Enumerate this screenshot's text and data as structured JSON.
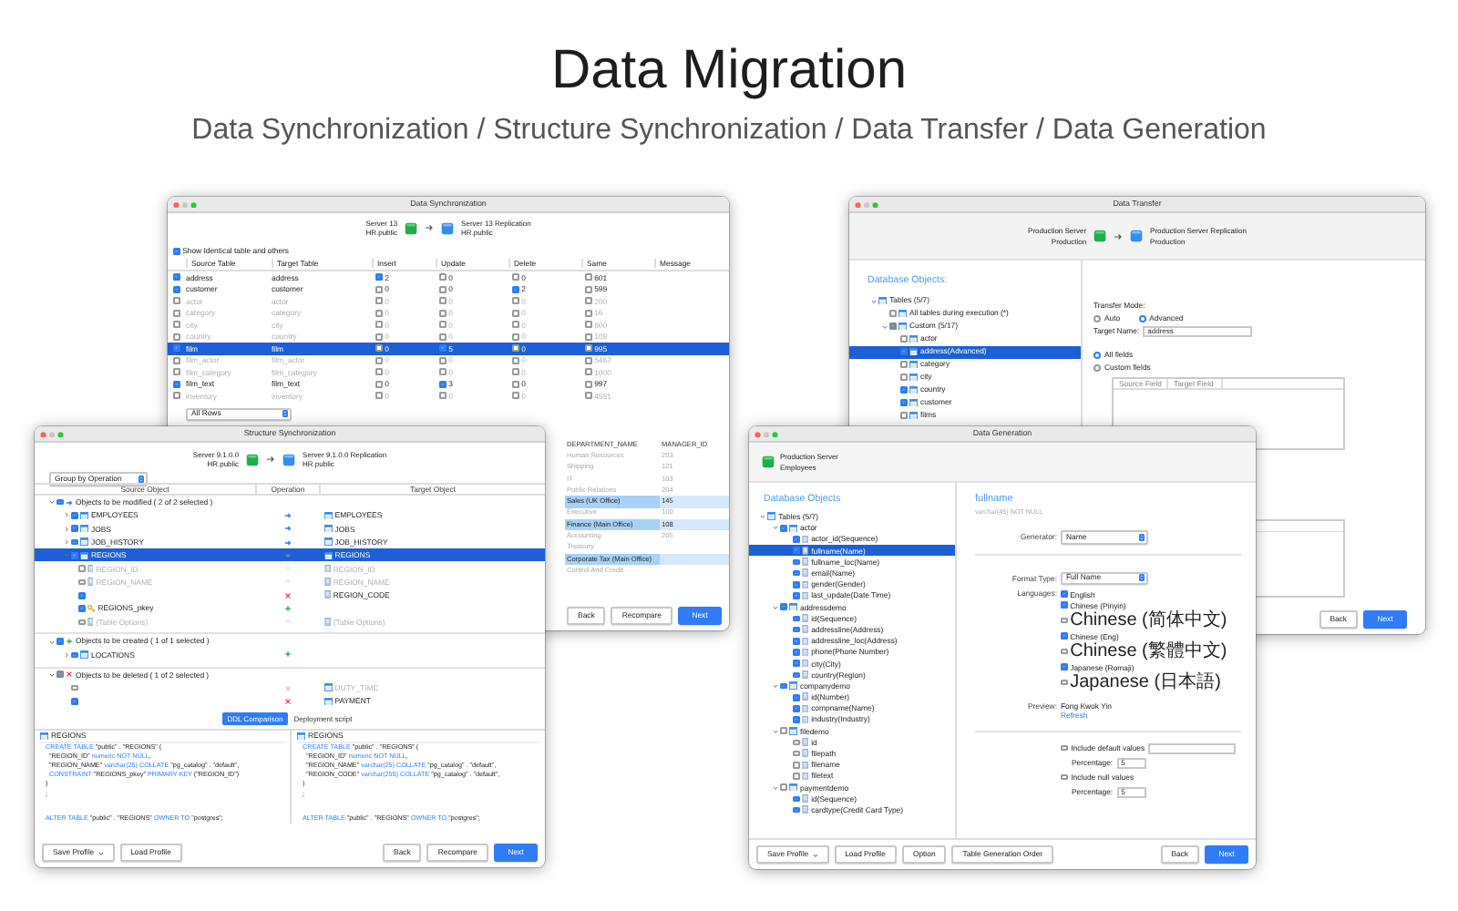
{
  "header": {
    "title": "Data Migration",
    "subtitle": "Data Synchronization / Structure Synchronization / Data Transfer / Data Generation"
  },
  "data_synchronization": {
    "title": "Data Synchronization",
    "source": {
      "name": "Server 13",
      "schema": "HR.public"
    },
    "target": {
      "name": "Server 13 Replication",
      "schema": "HR.public"
    },
    "show_identical": {
      "label": "Show Identical table and others",
      "checked": true
    },
    "columns": [
      "Source Table",
      "Target Table",
      "Insert",
      "Update",
      "Delete",
      "Same",
      "Message"
    ],
    "rows": [
      {
        "checked": true,
        "selected": false,
        "source": "address",
        "target": "address",
        "counts": [
          {
            "value": "2",
            "checked": true
          },
          {
            "value": "0",
            "checked": false
          },
          {
            "value": "0",
            "checked": false
          },
          {
            "value": "601",
            "checked": false
          }
        ]
      },
      {
        "checked": true,
        "selected": false,
        "source": "customer",
        "target": "customer",
        "counts": [
          {
            "value": "0",
            "checked": false
          },
          {
            "value": "0",
            "checked": false
          },
          {
            "value": "2",
            "checked": true
          },
          {
            "value": "599",
            "checked": false
          }
        ]
      },
      {
        "checked": false,
        "selected": false,
        "source": "actor",
        "target": "actor",
        "counts": [
          {
            "value": "0",
            "checked": false
          },
          {
            "value": "0",
            "checked": false
          },
          {
            "value": "0",
            "checked": false
          },
          {
            "value": "200",
            "checked": false
          }
        ]
      },
      {
        "checked": false,
        "selected": false,
        "source": "category",
        "target": "category",
        "counts": [
          {
            "value": "0",
            "checked": false
          },
          {
            "value": "0",
            "checked": false
          },
          {
            "value": "0",
            "checked": false
          },
          {
            "value": "16",
            "checked": false
          }
        ]
      },
      {
        "checked": false,
        "selected": false,
        "source": "city",
        "target": "city",
        "counts": [
          {
            "value": "0",
            "checked": false
          },
          {
            "value": "0",
            "checked": false
          },
          {
            "value": "0",
            "checked": false
          },
          {
            "value": "600",
            "checked": false
          }
        ]
      },
      {
        "checked": false,
        "selected": false,
        "source": "country",
        "target": "country",
        "counts": [
          {
            "value": "0",
            "checked": false
          },
          {
            "value": "0",
            "checked": false
          },
          {
            "value": "0",
            "checked": false
          },
          {
            "value": "109",
            "checked": false
          }
        ]
      },
      {
        "checked": true,
        "selected": true,
        "source": "film",
        "target": "film",
        "counts": [
          {
            "value": "0",
            "checked": false
          },
          {
            "value": "5",
            "checked": true
          },
          {
            "value": "0",
            "checked": false
          },
          {
            "value": "995",
            "checked": false
          }
        ]
      },
      {
        "checked": false,
        "selected": false,
        "source": "film_actor",
        "target": "film_actor",
        "counts": [
          {
            "value": "0",
            "checked": false
          },
          {
            "value": "0",
            "checked": false
          },
          {
            "value": "0",
            "checked": false
          },
          {
            "value": "5462",
            "checked": false
          }
        ]
      },
      {
        "checked": false,
        "selected": false,
        "source": "film_category",
        "target": "film_category",
        "counts": [
          {
            "value": "0",
            "checked": false
          },
          {
            "value": "0",
            "checked": false
          },
          {
            "value": "0",
            "checked": false
          },
          {
            "value": "1000",
            "checked": false
          }
        ]
      },
      {
        "checked": true,
        "selected": false,
        "source": "film_text",
        "target": "film_text",
        "counts": [
          {
            "value": "0",
            "checked": false
          },
          {
            "value": "3",
            "checked": true
          },
          {
            "value": "0",
            "checked": false
          },
          {
            "value": "997",
            "checked": false
          }
        ]
      },
      {
        "checked": false,
        "selected": false,
        "source": "inventory",
        "target": "inventory",
        "counts": [
          {
            "value": "0",
            "checked": false
          },
          {
            "value": "0",
            "checked": false
          },
          {
            "value": "0",
            "checked": false
          },
          {
            "value": "4581",
            "checked": false
          }
        ]
      }
    ],
    "filter": "All Rows",
    "preview": {
      "columns": [
        "DEPARTMENT_NAME",
        "MANAGER_ID"
      ],
      "rows": [
        {
          "cells": [
            "Human Resources",
            "203"
          ],
          "changed": false
        },
        {
          "cells": [
            "Shipping",
            "121"
          ],
          "changed": false
        },
        {
          "cells": [
            "IT",
            "103"
          ],
          "changed": false
        },
        {
          "cells": [
            "Public Relations",
            "204"
          ],
          "changed": false
        },
        {
          "cells": [
            "Sales (UK Office)",
            "145"
          ],
          "changed": true
        },
        {
          "cells": [
            "Executive",
            "100"
          ],
          "changed": false
        },
        {
          "cells": [
            "Finance (Main Office)",
            "108"
          ],
          "changed": true
        },
        {
          "cells": [
            "Accounting",
            "205"
          ],
          "changed": false
        },
        {
          "cells": [
            "Treasury"
          ],
          "changed": false
        },
        {
          "cells": [
            "Corporate Tax (Main Office)"
          ],
          "changed": true
        },
        {
          "cells": [
            "Control And Credit"
          ],
          "changed": false
        }
      ]
    },
    "buttons": [
      {
        "label": "Back",
        "primary": false
      },
      {
        "label": "Recompare",
        "primary": false
      },
      {
        "label": "Next",
        "primary": true
      }
    ]
  },
  "data_transfer": {
    "title": "Data Transfer",
    "source": {
      "name": "Production Server",
      "schema": "Production"
    },
    "target": {
      "name": "Production Server Replication",
      "schema": "Production"
    },
    "objects_heading": "Database Objects:",
    "tree": [
      {
        "label": "Tables (5/7)",
        "kind": "table",
        "expanded": true,
        "children": [
          {
            "label": "All tables during execution (*)",
            "kind": "table",
            "checked": false,
            "selected": false
          },
          {
            "label": "Custom (5/17)",
            "kind": "table",
            "checked": false,
            "indeterminate": true,
            "expanded": true,
            "children": [
              {
                "label": "actor",
                "kind": "table",
                "checked": false,
                "selected": false
              },
              {
                "label": "address(Advanced)",
                "kind": "table",
                "checked": true,
                "selected": true
              },
              {
                "label": "category",
                "kind": "table",
                "checked": false,
                "selected": false
              },
              {
                "label": "city",
                "kind": "table",
                "checked": false,
                "selected": false
              },
              {
                "label": "country",
                "kind": "table",
                "checked": true,
                "selected": false
              },
              {
                "label": "customer",
                "kind": "table",
                "checked": true,
                "selected": false
              },
              {
                "label": "films",
                "kind": "table",
                "checked": false,
                "selected": false
              }
            ]
          }
        ]
      }
    ],
    "mode_label": "Transfer Mode:",
    "modes": [
      {
        "label": "Auto",
        "selected": false
      },
      {
        "label": "Advanced",
        "selected": true
      }
    ],
    "target_name": {
      "label": "Target Name:",
      "value": "address"
    },
    "field_modes": [
      {
        "label": "All fields",
        "selected": true
      },
      {
        "label": "Custom fields",
        "selected": false
      }
    ],
    "field_columns": [
      "Source Field",
      "Target Field"
    ],
    "buttons": [
      {
        "label": "Back",
        "primary": false
      },
      {
        "label": "Next",
        "primary": true
      }
    ]
  },
  "structure_synchronization": {
    "title": "Structure Synchronization",
    "source": {
      "name": "Server 9.1.0.0",
      "schema": "HR.public"
    },
    "target": {
      "name": "Server 9.1.0.0 Replication",
      "schema": "HR.public"
    },
    "group_by": "Group by Operation",
    "columns": [
      "Source Object",
      "Operation",
      "Target Object"
    ],
    "groups": [
      {
        "kind": "modify",
        "label": "Objects to be modified ( 2 of 2 selected )",
        "checked": true,
        "indeterminate": false,
        "expanded": true,
        "items": [
          {
            "source": "EMPLOYEES",
            "target": "EMPLOYEES",
            "kind": "modify",
            "checked": true,
            "expanded": false,
            "selected": false
          },
          {
            "source": "JOBS",
            "target": "JOBS",
            "kind": "modify",
            "checked": true,
            "expanded": false,
            "selected": false
          },
          {
            "source": "JOB_HISTORY",
            "target": "JOB_HISTORY",
            "kind": "modify",
            "checked": true,
            "expanded": false,
            "selected": false
          },
          {
            "source": "REGIONS",
            "target": "REGIONS",
            "kind": "same",
            "checked": true,
            "expanded": true,
            "selected": true,
            "children": [
              {
                "source": "REGION_ID",
                "target": "REGION_ID",
                "kind": "same",
                "checked": false,
                "selected": false,
                "primary_key": false
              },
              {
                "source": "REGION_NAME",
                "target": "REGION_NAME",
                "kind": "same",
                "checked": false,
                "selected": false,
                "primary_key": false
              },
              {
                "target": "REGION_CODE",
                "kind": "delete",
                "checked": true,
                "selected": false,
                "primary_key": false
              },
              {
                "source": "REGIONS_pkey",
                "kind": "create",
                "checked": true,
                "selected": false,
                "primary_key": true
              },
              {
                "source": "(Table Options)",
                "target": "(Table Options)",
                "kind": "same",
                "checked": false,
                "selected": false,
                "primary_key": false
              }
            ]
          }
        ]
      },
      {
        "kind": "create",
        "label": "Objects to be created ( 1 of 1 selected )",
        "checked": true,
        "indeterminate": false,
        "expanded": true,
        "items": [
          {
            "source": "LOCATIONS",
            "kind": "create",
            "checked": true,
            "expanded": false,
            "selected": false
          }
        ]
      },
      {
        "kind": "delete",
        "label": "Objects to be deleted ( 1 of 2 selected )",
        "checked": false,
        "indeterminate": true,
        "expanded": true,
        "items": [
          {
            "target": "DUTY_TIME",
            "kind": "delete",
            "checked": false,
            "selected": false
          },
          {
            "target": "PAYMENT",
            "kind": "delete",
            "checked": true,
            "selected": false
          }
        ]
      }
    ],
    "tabs": [
      {
        "label": "DDL Comparison",
        "selected": true
      },
      {
        "label": "Deployment script",
        "selected": false
      }
    ],
    "ddl": [
      {
        "title": "REGIONS",
        "create_lines": [
          [
            {
              "text": "CREATE TABLE",
              "keyword": true
            },
            {
              "text": " \"public\" . \"REGIONS\" (",
              "keyword": false
            }
          ],
          [
            {
              "text": "  \"REGION_ID\" ",
              "keyword": false
            },
            {
              "text": "numeric NOT NULL",
              "keyword": true
            },
            {
              "text": ",",
              "keyword": false
            }
          ],
          [
            {
              "text": "  \"REGION_NAME\" ",
              "keyword": false
            },
            {
              "text": "varchar(25) COLLATE",
              "keyword": true
            },
            {
              "text": " \"pg_catalog\" . \"default\",",
              "keyword": false
            }
          ],
          [
            {
              "text": "  CONSTRAINT",
              "keyword": true
            },
            {
              "text": " \"REGIONS_pkey\" ",
              "keyword": false
            },
            {
              "text": "PRIMARY KEY",
              "keyword": true
            },
            {
              "text": " (\"REGION_ID\")",
              "keyword": false
            }
          ],
          [
            {
              "text": ")",
              "keyword": false
            }
          ],
          [
            {
              "text": ";",
              "keyword": false
            }
          ]
        ],
        "alter_line": [
          {
            "text": "ALTER TABLE",
            "keyword": true
          },
          {
            "text": " \"public\" . \"REGIONS\" ",
            "keyword": false
          },
          {
            "text": "OWNER TO",
            "keyword": true
          },
          {
            "text": " \"postgres\";",
            "keyword": false
          }
        ]
      },
      {
        "title": "REGIONS",
        "create_lines": [
          [
            {
              "text": "CREATE TABLE",
              "keyword": true
            },
            {
              "text": " \"public\" . \"REGIONS\" (",
              "keyword": false
            }
          ],
          [
            {
              "text": "  \"REGION_ID\" ",
              "keyword": false
            },
            {
              "text": "numeric NOT NULL",
              "keyword": true
            },
            {
              "text": ",",
              "keyword": false
            }
          ],
          [
            {
              "text": "  \"REGION_NAME\" ",
              "keyword": false
            },
            {
              "text": "varchar(25) COLLATE",
              "keyword": true
            },
            {
              "text": " \"pg_catalog\" . \"default\",",
              "keyword": false
            }
          ],
          [
            {
              "text": "  \"REGION_CODE\" ",
              "keyword": false
            },
            {
              "text": "varchar(255) COLLATE",
              "keyword": true
            },
            {
              "text": " \"pg_catalog\" . \"default\",",
              "keyword": false
            }
          ],
          [
            {
              "text": ")",
              "keyword": false
            }
          ],
          [
            {
              "text": ";",
              "keyword": false
            }
          ]
        ],
        "alter_line": [
          {
            "text": "ALTER TABLE",
            "keyword": true
          },
          {
            "text": " \"public\" . \"REGIONS\" ",
            "keyword": false
          },
          {
            "text": "OWNER TO",
            "keyword": true
          },
          {
            "text": " \"postgres\";",
            "keyword": false
          }
        ]
      }
    ],
    "left_buttons": [
      {
        "label": "Save Profile",
        "dropdown": true
      },
      {
        "label": "Load Profile",
        "dropdown": false
      }
    ],
    "buttons": [
      {
        "label": "Back",
        "primary": false
      },
      {
        "label": "Recompare",
        "primary": false
      },
      {
        "label": "Next",
        "primary": true
      }
    ]
  },
  "data_generation": {
    "title": "Data Generation",
    "server": {
      "name": "Production Server",
      "schema": "Employees"
    },
    "objects_heading": "Database Objects",
    "tree": [
      {
        "label": "Tables (5/7)",
        "kind": "table",
        "expanded": true,
        "children": [
          {
            "label": "actor",
            "kind": "table",
            "checked": true,
            "expanded": true,
            "selected": false,
            "children": [
              {
                "label": "actor_id(Sequence)",
                "kind": "column",
                "checked": true,
                "selected": false
              },
              {
                "label": "fullname(Name)",
                "kind": "column",
                "checked": true,
                "selected": true
              },
              {
                "label": "fullname_loc(Name)",
                "kind": "column",
                "checked": true,
                "selected": false
              },
              {
                "label": "email(Name)",
                "kind": "column",
                "checked": true,
                "selected": false
              },
              {
                "label": "gender(Gender)",
                "kind": "column",
                "checked": true,
                "selected": false
              },
              {
                "label": "last_update(Date Time)",
                "kind": "column",
                "checked": true,
                "selected": false
              }
            ]
          },
          {
            "label": "addressdemo",
            "kind": "table",
            "checked": true,
            "expanded": true,
            "selected": false,
            "children": [
              {
                "label": "id(Sequence)",
                "kind": "column",
                "checked": true,
                "selected": false
              },
              {
                "label": "addressline(Address)",
                "kind": "column",
                "checked": true,
                "selected": false
              },
              {
                "label": "addressline_loc(Address)",
                "kind": "column",
                "checked": true,
                "selected": false
              },
              {
                "label": "phone(Phone Number)",
                "kind": "column",
                "checked": true,
                "selected": false
              },
              {
                "label": "city(City)",
                "kind": "column",
                "checked": true,
                "selected": false
              },
              {
                "label": "country(Region)",
                "kind": "column",
                "checked": true,
                "selected": false
              }
            ]
          },
          {
            "label": "companydemo",
            "kind": "table",
            "checked": true,
            "expanded": true,
            "selected": false,
            "children": [
              {
                "label": "id(Number)",
                "kind": "column",
                "checked": true,
                "selected": false
              },
              {
                "label": "compname(Name)",
                "kind": "column",
                "checked": true,
                "selected": false
              },
              {
                "label": "industry(Industry)",
                "kind": "column",
                "checked": true,
                "selected": false
              }
            ]
          },
          {
            "label": "filedemo",
            "kind": "table",
            "checked": false,
            "expanded": true,
            "selected": false,
            "children": [
              {
                "label": "id",
                "kind": "column",
                "checked": false,
                "selected": false
              },
              {
                "label": "filepath",
                "kind": "column",
                "checked": false,
                "selected": false
              },
              {
                "label": "filename",
                "kind": "column",
                "checked": false,
                "selected": false
              },
              {
                "label": "filetext",
                "kind": "column",
                "checked": false,
                "selected": false
              }
            ]
          },
          {
            "label": "paymentdemo",
            "kind": "table",
            "checked": false,
            "expanded": true,
            "selected": false,
            "children": [
              {
                "label": "id(Sequence)",
                "kind": "column",
                "checked": true,
                "selected": false
              },
              {
                "label": "cardtype(Credit Card Type)",
                "kind": "column",
                "checked": true,
                "selected": false
              }
            ]
          }
        ]
      }
    ],
    "field": {
      "name": "fullname",
      "type": "varchar(45) NOT NULL"
    },
    "generator": {
      "label": "Generator:",
      "value": "Name"
    },
    "format_type": {
      "label": "Format Type:",
      "value": "Full Name"
    },
    "languages_label": "Languages:",
    "languages": [
      {
        "label": "English",
        "checked": true
      },
      {
        "label": "Chinese (Pinyin)",
        "checked": true
      },
      {
        "label": "Chinese (简体中文)",
        "checked": false
      },
      {
        "label": "Chinese (Eng)",
        "checked": true
      },
      {
        "label": "Chinese (繁體中文)",
        "checked": false
      },
      {
        "label": "Japanese (Romaji)",
        "checked": true
      },
      {
        "label": "Japanese (日本語)",
        "checked": false
      }
    ],
    "preview": {
      "label": "Preview:",
      "value": "Fong Kwok Yin",
      "action": "Refresh"
    },
    "include_default": {
      "label": "Include default values",
      "checked": false
    },
    "default_percentage": {
      "label": "Percentage:",
      "value": "5"
    },
    "include_null": {
      "label": "Include null values",
      "checked": false
    },
    "null_percentage": {
      "label": "Percentage:",
      "value": "5"
    },
    "left_buttons": [
      {
        "label": "Save Profile",
        "dropdown": true
      },
      {
        "label": "Load Profile",
        "dropdown": false
      },
      {
        "label": "Option",
        "dropdown": false
      },
      {
        "label": "Table Generation Order",
        "dropdown": false
      }
    ],
    "buttons": [
      {
        "label": "Back",
        "primary": false
      },
      {
        "label": "Next",
        "primary": true
      }
    ]
  }
}
